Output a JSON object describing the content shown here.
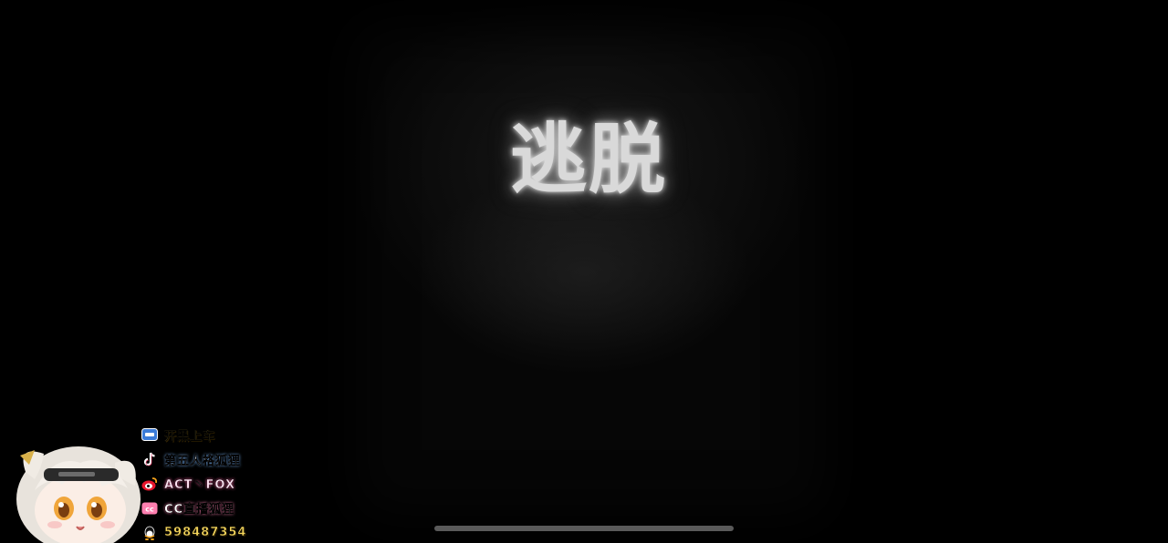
{
  "game": {
    "title": "逃脱"
  },
  "overlay": {
    "items": [
      {
        "icon": "game-controller-icon",
        "text": "开黑上车"
      },
      {
        "icon": "tiktok-icon",
        "text": "第五人格狐狸"
      },
      {
        "icon": "weibo-icon",
        "text": "ACT丶FOX"
      },
      {
        "icon": "cc-live-icon",
        "text": "CC直播狐狸"
      },
      {
        "icon": "qq-icon",
        "text": "598487354"
      }
    ]
  },
  "colors": {
    "background": "#000000",
    "title_glow": "#d9d9d9",
    "overlay_text": "#f2d35a",
    "home_indicator": "#5a5a5a"
  }
}
